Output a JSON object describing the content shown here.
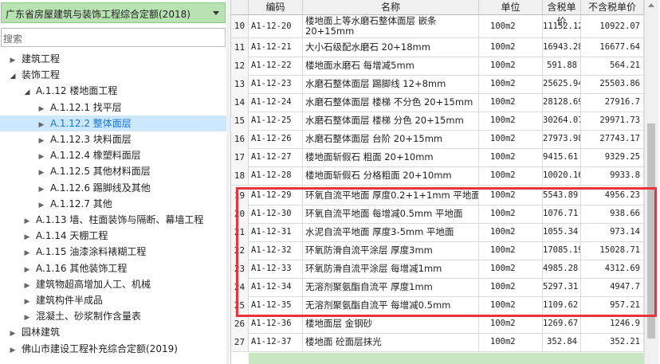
{
  "left": {
    "quota_select_value": "广东省房屋建筑与装饰工程综合定额(2018)",
    "search_placeholder": "搜索",
    "tree": [
      {
        "label": "建筑工程",
        "expanded": false
      },
      {
        "label": "装饰工程",
        "expanded": true
      },
      {
        "label": "A.1.12 楼地面工程",
        "expanded": true
      },
      {
        "label": "A.1.12.1 找平层",
        "expanded": false
      },
      {
        "label": "A.1.12.2 整体面层",
        "expanded": false,
        "selected": true
      },
      {
        "label": "A.1.12.3 块料面层",
        "expanded": false
      },
      {
        "label": "A.1.12.4 橡塑料面层",
        "expanded": false
      },
      {
        "label": "A.1.12.5 其他材料面层",
        "expanded": false
      },
      {
        "label": "A.1.12.6 踢脚线及其他",
        "expanded": false
      },
      {
        "label": "A.1.12.7 其他",
        "expanded": false
      },
      {
        "label": "A.1.13 墙、柱面装饰与隔断、幕墙工程",
        "expanded": false
      },
      {
        "label": "A.1.14 天棚工程",
        "expanded": false
      },
      {
        "label": "A.1.15 油漆涂料裱糊工程",
        "expanded": false
      },
      {
        "label": "A.1.16 其他装饰工程",
        "expanded": false
      },
      {
        "label": "建筑物超高增加人工、机械",
        "expanded": false
      },
      {
        "label": "建筑构件半成品",
        "expanded": false
      },
      {
        "label": "混凝土、砂浆制作含量表",
        "expanded": false
      },
      {
        "label": "园林建筑",
        "expanded": false
      },
      {
        "label": "佛山市建设工程补充综合定额(2019)",
        "expanded": false
      }
    ]
  },
  "grid": {
    "columns": [
      "",
      "编码",
      "名称",
      "单位",
      "含税单价",
      "不含税单价"
    ],
    "rows": [
      {
        "num": "10",
        "code": "A1-12-20",
        "name": "楼地面上等水磨石整体面层 嵌条",
        "name2": "20+15mm",
        "unit": "100m2",
        "tax": "11152.12",
        "ntax": "10922.07"
      },
      {
        "num": "11",
        "code": "A1-12-21",
        "name": "大小石级配水磨石 20+18mm",
        "unit": "100m2",
        "tax": "16943.28",
        "ntax": "16677.64"
      },
      {
        "num": "12",
        "code": "A1-12-22",
        "name": "楼地面水磨石 每增减5mm",
        "unit": "100m2",
        "tax": "591.88",
        "ntax": "564.21"
      },
      {
        "num": "13",
        "code": "A1-12-23",
        "name": "水磨石整体面层 踢脚线 12+8mm",
        "unit": "100m2",
        "tax": "25625.94",
        "ntax": "25503.86"
      },
      {
        "num": "14",
        "code": "A1-12-24",
        "name": "水磨石整体面层 楼梯 不分色 20+15mm",
        "unit": "100m2",
        "tax": "28128.69",
        "ntax": "27916.7"
      },
      {
        "num": "15",
        "code": "A1-12-25",
        "name": "水磨石整体面层 楼梯 分色 20+15mm",
        "unit": "100m2",
        "tax": "30264.07",
        "ntax": "29971.73"
      },
      {
        "num": "16",
        "code": "A1-12-26",
        "name": "水磨石整体面层 台阶 20+15mm",
        "unit": "100m2",
        "tax": "27973.98",
        "ntax": "27743.17"
      },
      {
        "num": "17",
        "code": "A1-12-27",
        "name": "楼地面斩假石 粗面 20+10mm",
        "unit": "100m2",
        "tax": "9415.61",
        "ntax": "9329.25"
      },
      {
        "num": "18",
        "code": "A1-12-28",
        "name": "楼地面斩假石 分格粗面 20+10mm",
        "unit": "100m2",
        "tax": "10020.16",
        "ntax": "9933.8"
      },
      {
        "num": "19",
        "code": "A1-12-29",
        "name": "环氧自流平地面 厚度0.2+1+1mm 平地面",
        "unit": "100m2",
        "tax": "5543.89",
        "ntax": "4956.23"
      },
      {
        "num": "20",
        "code": "A1-12-30",
        "name": "环氧自流平地面 每增减0.5mm 平地面",
        "unit": "100m2",
        "tax": "1076.71",
        "ntax": "938.66"
      },
      {
        "num": "21",
        "code": "A1-12-31",
        "name": "水泥自流平地面 厚度3-5mm 平地面",
        "unit": "100m2",
        "tax": "1055.34",
        "ntax": "973.14"
      },
      {
        "num": "22",
        "code": "A1-12-32",
        "name": "环氧防滑自流平涂层 厚度3mm",
        "unit": "100m2",
        "tax": "17085.19",
        "ntax": "15028.71"
      },
      {
        "num": "23",
        "code": "A1-12-33",
        "name": "环氧防滑自流平涂层 每增减1mm",
        "unit": "100m2",
        "tax": "4985.28",
        "ntax": "4312.69"
      },
      {
        "num": "24",
        "code": "A1-12-34",
        "name": "无溶剂聚氨酯自流平 厚度1mm",
        "unit": "100m2",
        "tax": "5297.31",
        "ntax": "4947.7"
      },
      {
        "num": "25",
        "code": "A1-12-35",
        "name": "无溶剂聚氨酯自流平 每增减0.5mm",
        "unit": "100m2",
        "tax": "1109.62",
        "ntax": "957.21"
      },
      {
        "num": "26",
        "code": "A1-12-36",
        "name": "楼地面层 金钢砂",
        "unit": "100m2",
        "tax": "1269.67",
        "ntax": "1246.9"
      },
      {
        "num": "27",
        "code": "A1-12-37",
        "name": "楼地面 砼面层抹光",
        "unit": "100m2",
        "tax": "352.84",
        "ntax": "352.21"
      }
    ]
  },
  "colors": {
    "select_bg": "#b9e2b3",
    "selected_node": "#cce8ff",
    "highlight": "#e8323c"
  }
}
